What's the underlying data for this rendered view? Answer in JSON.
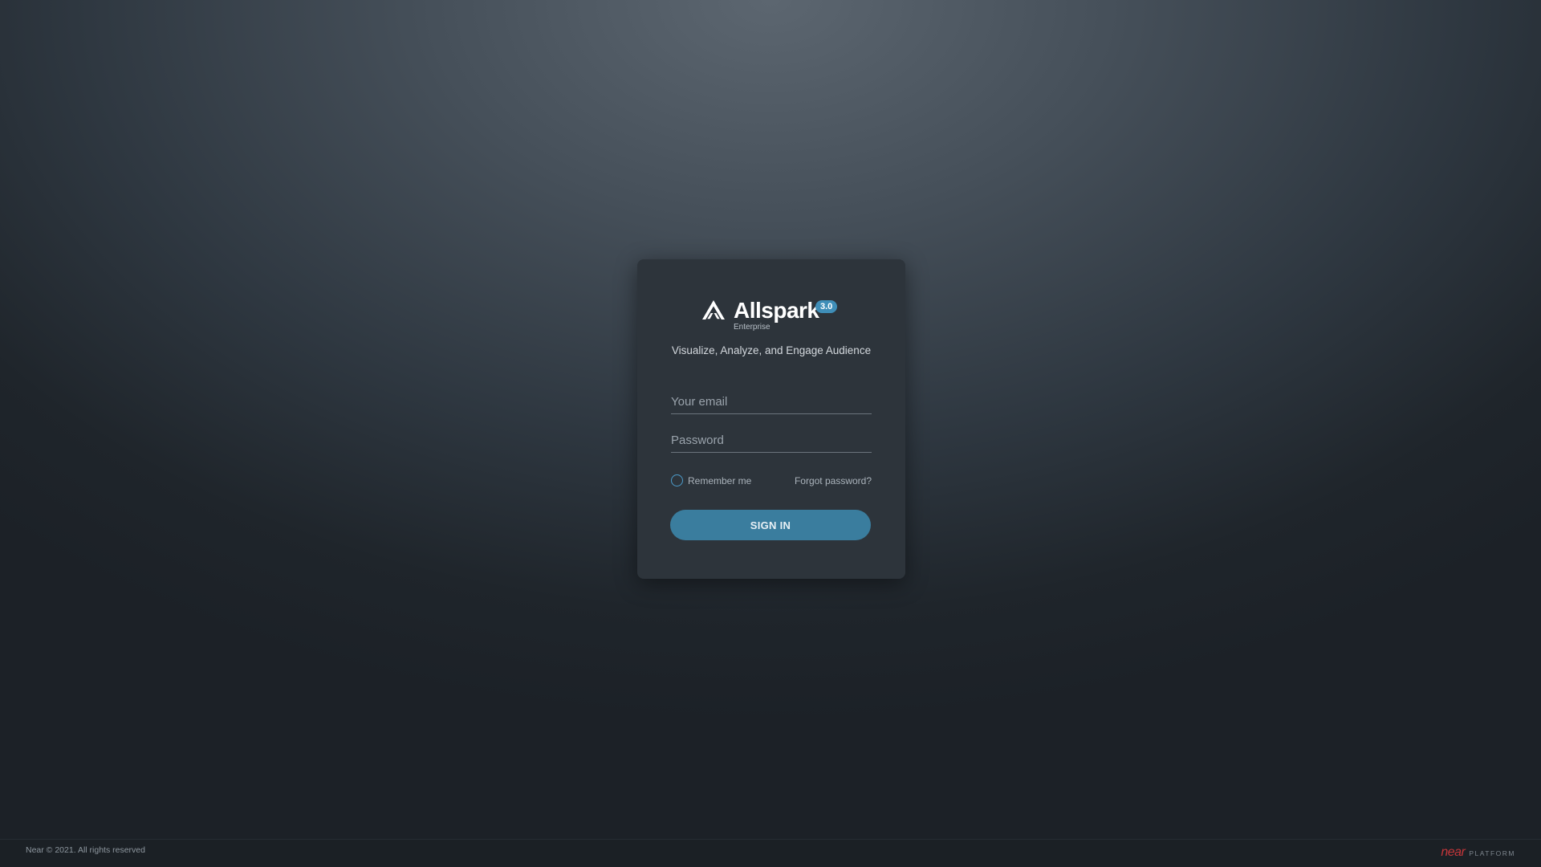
{
  "app": {
    "name": "Allspark",
    "version": "3.0",
    "edition": "Enterprise",
    "tagline": "Visualize, Analyze, and Engage Audience",
    "logo_icon": "allspark-logo-icon"
  },
  "login": {
    "email_placeholder": "Your email",
    "password_placeholder": "Password",
    "remember_label": "Remember me",
    "forgot_label": "Forgot password?",
    "signin_label": "SIGN IN"
  },
  "footer": {
    "copyright": "Near © 2021. All rights reserved",
    "brand_word": "near",
    "brand_suffix": "PLATFORM"
  },
  "colors": {
    "accent": "#3a7d9e",
    "badge": "#3f8eb8",
    "near_red": "#c4363a"
  }
}
